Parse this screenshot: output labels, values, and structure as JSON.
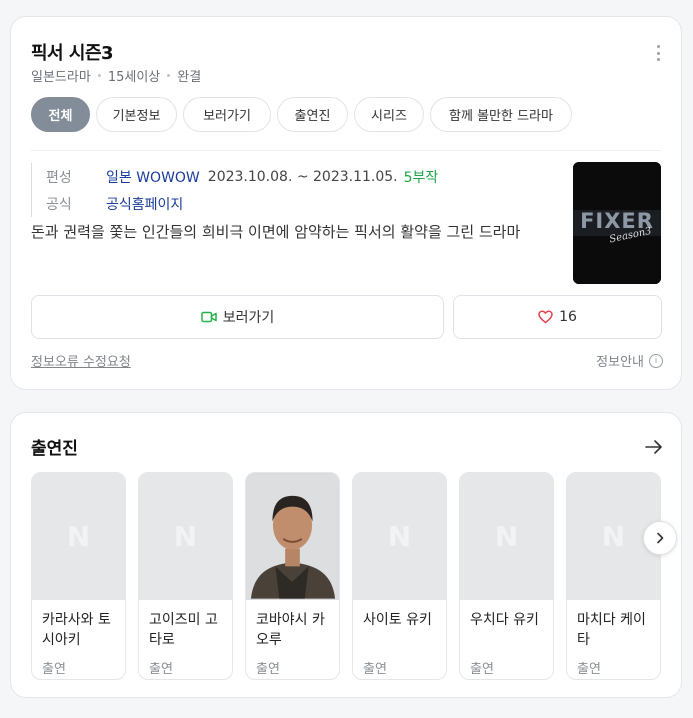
{
  "drama": {
    "title": "픽서 시즌3",
    "meta": [
      "일본드라마",
      "15세이상",
      "완결"
    ]
  },
  "tabs": [
    {
      "label": "전체",
      "active": true
    },
    {
      "label": "기본정보"
    },
    {
      "label": "보러가기"
    },
    {
      "label": "출연진"
    },
    {
      "label": "시리즈"
    },
    {
      "label": "함께 볼만한 드라마"
    }
  ],
  "info": {
    "broadcast_label": "편성",
    "broadcast_link": "일본 WOWOW",
    "broadcast_period": "2023.10.08. ~ 2023.11.05.",
    "episodes": "5부작",
    "official_label": "공식",
    "official_link": "공식홈페이지"
  },
  "description": "돈과 권력을 쫓는 인간들의 희비극 이면에 암약하는 픽서의 활약을 그린 드라마",
  "poster": {
    "title_text": "FIXER",
    "sub_text": "Season3"
  },
  "actions": {
    "watch_label": "보러가기",
    "like_count": "16"
  },
  "footer": {
    "fix_request": "정보오류 수정요청",
    "info_guide": "정보안내"
  },
  "cast_section": {
    "title": "출연진",
    "placeholder_letter": "N",
    "members": [
      {
        "name": "카라사와 토시아키",
        "role": "출연",
        "photo": false
      },
      {
        "name": "고이즈미 고타로",
        "role": "출연",
        "photo": false
      },
      {
        "name": "코바야시 카오루",
        "role": "출연",
        "photo": true
      },
      {
        "name": "사이토 유키",
        "role": "출연",
        "photo": false
      },
      {
        "name": "우치다 유키",
        "role": "출연",
        "photo": false
      },
      {
        "name": "마치다 케이타",
        "role": "출연",
        "photo": false
      }
    ]
  },
  "colors": {
    "active_tab": "#838c99",
    "link": "#1a3c9a",
    "green": "#1fa44a",
    "heart": "#e0434d"
  }
}
